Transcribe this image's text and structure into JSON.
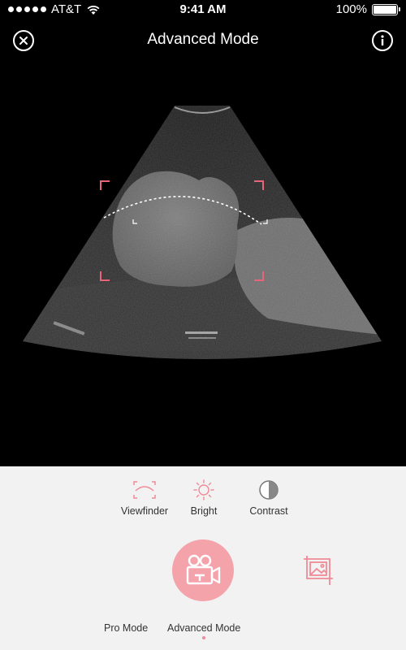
{
  "status_bar": {
    "carrier": "AT&T",
    "time": "9:41 AM",
    "battery": "100%"
  },
  "nav": {
    "title": "Advanced Mode",
    "close_icon": "close-circle-icon",
    "info_icon": "info-circle-icon"
  },
  "tools": [
    {
      "label": "Viewfinder",
      "icon": "viewfinder-icon"
    },
    {
      "label": "Bright",
      "icon": "sun-icon"
    },
    {
      "label": "Contrast",
      "icon": "contrast-icon"
    }
  ],
  "actions": {
    "record_icon": "video-camera-icon",
    "gallery_icon": "gallery-icon"
  },
  "modes": [
    {
      "label": "Pro Mode",
      "active": false
    },
    {
      "label": "Advanced Mode",
      "active": true
    }
  ],
  "colors": {
    "accent": "#f5a3ab",
    "accent_dark": "#f08a96",
    "viewfinder_corner": "#e8647a",
    "panel_bg": "#f2f2f2"
  }
}
